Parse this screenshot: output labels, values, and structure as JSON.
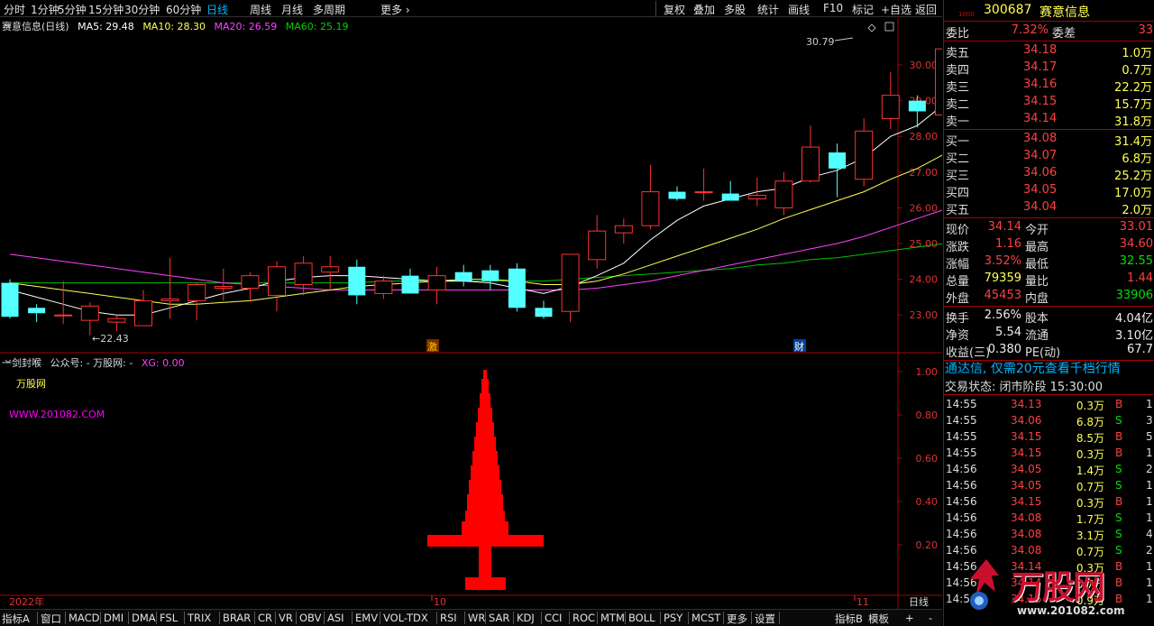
{
  "toolbar": {
    "periods": [
      "分时",
      "1分钟",
      "5分钟",
      "15分钟",
      "30分钟",
      "60分钟",
      "日线",
      "周线",
      "月线",
      "多周期",
      "更多"
    ],
    "active_period": "日线",
    "tools": [
      "复权",
      "叠加",
      "多股",
      "统计",
      "画线",
      "F10",
      "标记",
      "+自选",
      "返回"
    ]
  },
  "chart_header": {
    "title": "赛意信息(日线)",
    "ma5": "MA5: 29.48",
    "ma10": "MA10: 28.30",
    "ma20": "MA20: 26.59",
    "ma60": "MA60: 25.19"
  },
  "price_axis": [
    "30.00",
    "29.00",
    "28.00",
    "27.00",
    "26.00",
    "25.00",
    "24.00",
    "23.00"
  ],
  "annotations": {
    "high": "30.79",
    "low": "22.43",
    "mark_ji": "激",
    "mark_cai": "财"
  },
  "indicator_header": {
    "name": "一剑封喉",
    "gzh": "公众号: - 万股网: -",
    "xg": "XG: 0.00"
  },
  "indicator_text": {
    "line1": "万股网",
    "line2": "WWW.201082.COM"
  },
  "indicator_axis": [
    "1.00",
    "0.80",
    "0.60",
    "0.40",
    "0.20"
  ],
  "date_axis": {
    "year": "2022年",
    "m10": "10",
    "m11": "11"
  },
  "bottom_tabs": [
    "指标A",
    "窗口",
    "MACD",
    "DMI",
    "DMA",
    "FSL",
    "TRIX",
    "BRAR",
    "CR",
    "VR",
    "OBV",
    "ASI",
    "EMV",
    "VOL-TDX",
    "RSI",
    "WR",
    "SAR",
    "KDJ",
    "CCI",
    "ROC",
    "MTM",
    "BOLL",
    "PSY",
    "MCST",
    "更多",
    "设置"
  ],
  "bottom_right": {
    "indicator_b": "指标B",
    "template": "模板",
    "plus": "+",
    "minus": "-",
    "period": "日线"
  },
  "quote": {
    "small_label": "1000",
    "code": "300687",
    "name": "赛意信息",
    "weibi_label": "委比",
    "weibi": "7.32%",
    "weicha_label": "委差",
    "weicha": "33",
    "sell": [
      {
        "label": "卖五",
        "price": "34.18",
        "vol": "1.0万"
      },
      {
        "label": "卖四",
        "price": "34.17",
        "vol": "0.7万"
      },
      {
        "label": "卖三",
        "price": "34.16",
        "vol": "22.2万"
      },
      {
        "label": "卖二",
        "price": "34.15",
        "vol": "15.7万"
      },
      {
        "label": "卖一",
        "price": "34.14",
        "vol": "31.8万"
      }
    ],
    "buy": [
      {
        "label": "买一",
        "price": "34.08",
        "vol": "31.4万"
      },
      {
        "label": "买二",
        "price": "34.07",
        "vol": "6.8万"
      },
      {
        "label": "买三",
        "price": "34.06",
        "vol": "25.2万"
      },
      {
        "label": "买四",
        "price": "34.05",
        "vol": "17.0万"
      },
      {
        "label": "买五",
        "price": "34.04",
        "vol": "2.0万"
      }
    ],
    "stats": [
      {
        "l": "现价",
        "v": "34.14",
        "l2": "今开",
        "v2": "33.01"
      },
      {
        "l": "涨跌",
        "v": "1.16",
        "l2": "最高",
        "v2": "34.60"
      },
      {
        "l": "涨幅",
        "v": "3.52%",
        "l2": "最低",
        "v2": "32.55"
      },
      {
        "l": "总量",
        "v": "79359",
        "l2": "量比",
        "v2": "1.44"
      },
      {
        "l": "外盘",
        "v": "45453",
        "l2": "内盘",
        "v2": "33906"
      }
    ],
    "fin": [
      {
        "l": "换手",
        "v": "2.56%",
        "l2": "股本",
        "v2": "4.04亿"
      },
      {
        "l": "净资",
        "v": "5.54",
        "l2": "流通",
        "v2": "3.10亿"
      },
      {
        "l": "收益(三)",
        "v": "0.380",
        "l2": "PE(动)",
        "v2": "67.7"
      }
    ],
    "promo": "通达信, 仅需20元查看千档行情",
    "trade_status": "交易状态: 闭市阶段 15:30:00",
    "ticks": [
      {
        "t": "14:55",
        "p": "34.13",
        "q": "0.3万",
        "s": "B",
        "n": "1"
      },
      {
        "t": "14:55",
        "p": "34.06",
        "q": "6.8万",
        "s": "S",
        "n": "3"
      },
      {
        "t": "14:55",
        "p": "34.15",
        "q": "8.5万",
        "s": "B",
        "n": "5"
      },
      {
        "t": "14:55",
        "p": "34.15",
        "q": "0.3万",
        "s": "B",
        "n": "1"
      },
      {
        "t": "14:56",
        "p": "34.05",
        "q": "1.4万",
        "s": "S",
        "n": "2"
      },
      {
        "t": "14:56",
        "p": "34.05",
        "q": "0.7万",
        "s": "S",
        "n": "1"
      },
      {
        "t": "14:56",
        "p": "34.15",
        "q": "0.3万",
        "s": "B",
        "n": "1"
      },
      {
        "t": "14:56",
        "p": "34.08",
        "q": "1.7万",
        "s": "S",
        "n": "1"
      },
      {
        "t": "14:56",
        "p": "34.08",
        "q": "3.1万",
        "s": "S",
        "n": "4"
      },
      {
        "t": "14:56",
        "p": "34.08",
        "q": "0.7万",
        "s": "S",
        "n": "2"
      },
      {
        "t": "14:56",
        "p": "34.14",
        "q": "0.3万",
        "s": "B",
        "n": "1"
      },
      {
        "t": "14:56",
        "p": "34.14",
        "q": "0.7万",
        "s": "B",
        "n": "1"
      },
      {
        "t": "14:56",
        "p": "34.15",
        "q": "0.9万",
        "s": "B",
        "n": "1"
      }
    ],
    "watermark": "万股网",
    "watermark_url": "www.201082.com"
  },
  "colors": {
    "up": "#ff3232",
    "down": "#54ffff",
    "ma5": "#ffffff",
    "ma10": "#ffff55",
    "ma20": "#ff40ff",
    "ma60": "#00c000",
    "ma_long": "#d040d0"
  },
  "chart_data": {
    "type": "candlestick",
    "ohlc": [
      [
        23.9,
        24.0,
        22.9,
        22.95
      ],
      [
        23.2,
        23.3,
        22.8,
        23.05
      ],
      [
        23.0,
        23.95,
        22.75,
        23.0
      ],
      [
        22.85,
        23.35,
        22.43,
        23.25
      ],
      [
        22.8,
        23.0,
        22.55,
        22.9
      ],
      [
        22.7,
        23.7,
        22.7,
        23.4
      ],
      [
        23.4,
        24.6,
        22.9,
        23.45
      ],
      [
        23.4,
        23.9,
        22.85,
        23.85
      ],
      [
        23.75,
        24.3,
        23.4,
        23.8
      ],
      [
        23.75,
        24.2,
        23.4,
        24.1
      ],
      [
        23.55,
        24.5,
        23.1,
        24.35
      ],
      [
        23.85,
        24.65,
        23.55,
        24.45
      ],
      [
        24.2,
        24.65,
        23.7,
        24.35
      ],
      [
        24.35,
        24.55,
        23.3,
        23.55
      ],
      [
        23.6,
        24.1,
        23.45,
        23.95
      ],
      [
        24.1,
        24.3,
        23.7,
        23.6
      ],
      [
        23.7,
        24.35,
        23.3,
        24.1
      ],
      [
        24.2,
        24.4,
        23.8,
        23.95
      ],
      [
        24.25,
        24.4,
        23.7,
        23.95
      ],
      [
        24.3,
        24.45,
        23.1,
        23.2
      ],
      [
        23.2,
        23.4,
        22.9,
        22.95
      ],
      [
        23.1,
        24.7,
        22.8,
        24.7
      ],
      [
        24.55,
        25.8,
        24.3,
        25.35
      ],
      [
        25.3,
        25.7,
        25.0,
        25.5
      ],
      [
        25.5,
        27.2,
        25.4,
        26.45
      ],
      [
        26.45,
        26.6,
        26.2,
        26.25
      ],
      [
        26.45,
        27.1,
        26.2,
        26.45
      ],
      [
        26.4,
        26.75,
        26.2,
        26.2
      ],
      [
        26.25,
        26.85,
        26.05,
        26.35
      ],
      [
        26.0,
        27.0,
        25.8,
        26.75
      ],
      [
        26.75,
        28.3,
        26.7,
        27.7
      ],
      [
        27.55,
        27.8,
        26.3,
        27.1
      ],
      [
        26.8,
        28.5,
        26.6,
        28.15
      ],
      [
        28.5,
        29.8,
        28.2,
        29.15
      ],
      [
        29.0,
        29.15,
        28.25,
        28.7
      ],
      [
        28.6,
        30.5,
        28.4,
        30.45
      ],
      [
        30.5,
        30.79,
        29.5,
        30.0
      ],
      [
        29.9,
        30.1,
        28.8,
        29.0
      ]
    ],
    "ma5": [
      23.7,
      23.5,
      23.3,
      23.1,
      23.0,
      23.0,
      23.2,
      23.4,
      23.6,
      23.75,
      23.95,
      24.05,
      24.1,
      24.1,
      24.05,
      24.0,
      23.95,
      23.95,
      23.9,
      23.75,
      23.6,
      23.8,
      24.1,
      24.45,
      25.1,
      25.65,
      26.05,
      26.25,
      26.45,
      26.55,
      26.85,
      27.05,
      27.4,
      28.0,
      28.3,
      28.9,
      29.3,
      29.48
    ],
    "ma10": [
      23.9,
      23.8,
      23.7,
      23.6,
      23.5,
      23.4,
      23.3,
      23.3,
      23.35,
      23.4,
      23.5,
      23.6,
      23.7,
      23.8,
      23.85,
      23.9,
      23.95,
      24.0,
      24.0,
      23.95,
      23.85,
      23.85,
      23.95,
      24.15,
      24.4,
      24.65,
      24.9,
      25.15,
      25.4,
      25.7,
      25.95,
      26.2,
      26.45,
      26.8,
      27.1,
      27.5,
      27.9,
      28.3
    ],
    "ma20": [
      24.7,
      24.6,
      24.5,
      24.4,
      24.3,
      24.2,
      24.1,
      24.0,
      23.9,
      23.85,
      23.8,
      23.75,
      23.7,
      23.7,
      23.7,
      23.7,
      23.7,
      23.7,
      23.7,
      23.7,
      23.7,
      23.7,
      23.75,
      23.85,
      23.95,
      24.1,
      24.25,
      24.4,
      24.55,
      24.7,
      24.85,
      25.0,
      25.2,
      25.45,
      25.7,
      25.95,
      26.25,
      26.59
    ],
    "ma60": [
      23.9,
      23.9,
      23.9,
      23.9,
      23.9,
      23.9,
      23.9,
      23.9,
      23.9,
      23.9,
      23.9,
      23.9,
      23.9,
      23.9,
      23.95,
      23.95,
      23.95,
      23.95,
      23.95,
      23.95,
      23.95,
      24.0,
      24.05,
      24.1,
      24.15,
      24.2,
      24.25,
      24.3,
      24.4,
      24.45,
      24.55,
      24.6,
      24.7,
      24.8,
      24.9,
      25.0,
      25.1,
      25.19
    ],
    "xg_signal_index": 18,
    "xg_value": 0.0
  }
}
